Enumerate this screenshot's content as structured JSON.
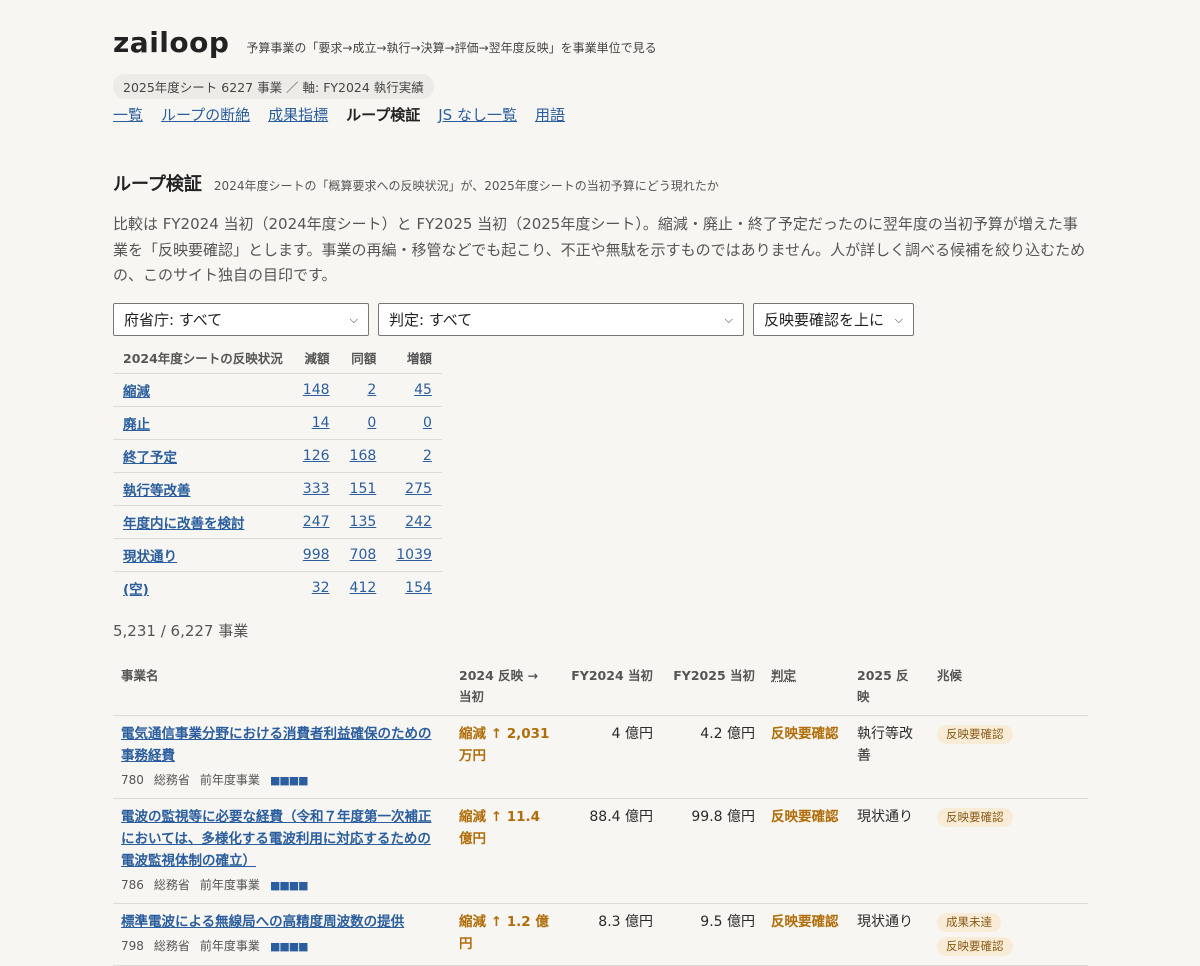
{
  "site": {
    "logo": "zailoop",
    "tagline": "予算事業の「要求→成立→執行→決算→評価→翌年度反映」を事業単位で見る",
    "pill": "2025年度シート 6227 事業 ／ 軸: FY2024 執行実績"
  },
  "nav": {
    "items": [
      {
        "label": "一覧"
      },
      {
        "label": "ループの断絶"
      },
      {
        "label": "成果指標"
      },
      {
        "label": "ループ検証"
      },
      {
        "label": "JS なし一覧"
      },
      {
        "label": "用語"
      }
    ]
  },
  "section": {
    "title": "ループ検証",
    "subtitle": "2024年度シートの「概算要求への反映状況」が、2025年度シートの当初予算にどう現れたか",
    "description": "比較は FY2024 当初（2024年度シート）と FY2025 当初（2025年度シート）。縮減・廃止・終了予定だったのに翌年度の当初予算が増えた事業を「反映要確認」とします。事業の再編・移管などでも起こり、不正や無駄を示すものではありません。人が詳しく調べる候補を絞り込むための、このサイト独自の目印です。"
  },
  "filters": {
    "ministry": "府省庁: すべて",
    "judgement": "判定: すべて",
    "sort": "反映要確認を上に"
  },
  "summary": {
    "headers": [
      "2024年度シートの反映状況",
      "減額",
      "同額",
      "増額"
    ],
    "rows": [
      {
        "label": "縮減",
        "dec": "148",
        "same": "2",
        "inc": "45"
      },
      {
        "label": "廃止",
        "dec": "14",
        "same": "0",
        "inc": "0"
      },
      {
        "label": "終了予定",
        "dec": "126",
        "same": "168",
        "inc": "2"
      },
      {
        "label": "執行等改善",
        "dec": "333",
        "same": "151",
        "inc": "275"
      },
      {
        "label": "年度内に改善を検討",
        "dec": "247",
        "same": "135",
        "inc": "242"
      },
      {
        "label": "現状通り",
        "dec": "998",
        "same": "708",
        "inc": "1039"
      },
      {
        "label": "(空)",
        "dec": "32",
        "same": "412",
        "inc": "154"
      }
    ]
  },
  "count": "5,231 / 6,227 事業",
  "table": {
    "headers": {
      "name": "事業名",
      "reflect": "2024 反映 → 当初",
      "fy2024": "FY2024 当初",
      "fy2025": "FY2025 当初",
      "judge": "判定",
      "reflect2025": "2025 反映",
      "signs": "兆候"
    },
    "rows": [
      {
        "name": "電気通信事業分野における消費者利益確保のための事務経費",
        "id": "780",
        "ministry": "総務省",
        "kind": "前年度事業",
        "squares": "■■■■",
        "reflect": "縮減 ↑ 2,031 万円",
        "fy2024": "4 億円",
        "fy2025": "4.2 億円",
        "judge": "反映要確認",
        "reflect2025": "執行等改善",
        "badges": [
          "反映要確認"
        ]
      },
      {
        "name": "電波の監視等に必要な経費（令和７年度第一次補正においては、多様化する電波利用に対応するための電波監視体制の確立）",
        "id": "786",
        "ministry": "総務省",
        "kind": "前年度事業",
        "squares": "■■■■",
        "reflect": "縮減 ↑ 11.4 億円",
        "fy2024": "88.4 億円",
        "fy2025": "99.8 億円",
        "judge": "反映要確認",
        "reflect2025": "現状通り",
        "badges": [
          "反映要確認"
        ]
      },
      {
        "name": "標準電波による無線局への高精度周波数の提供",
        "id": "798",
        "ministry": "総務省",
        "kind": "前年度事業",
        "squares": "■■■■",
        "reflect": "縮減 ↑ 1.2 億円",
        "fy2024": "8.3 億円",
        "fy2025": "9.5 億円",
        "judge": "反映要確認",
        "reflect2025": "現状通り",
        "badges": [
          "成果未達",
          "反映要確認"
        ]
      }
    ]
  }
}
